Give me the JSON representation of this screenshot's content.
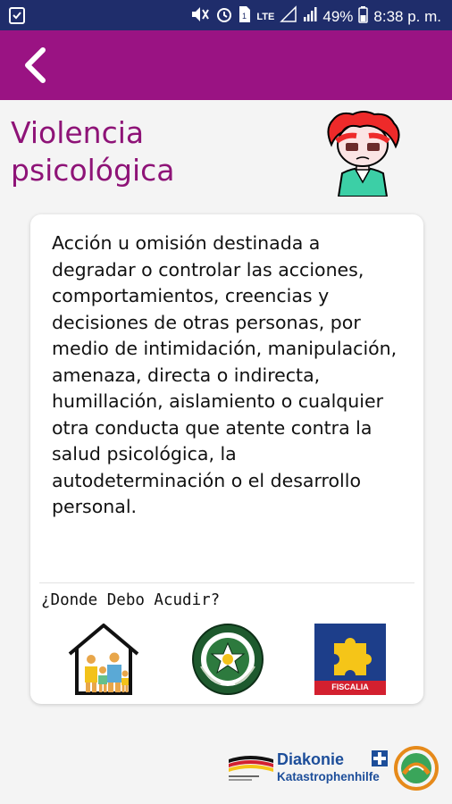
{
  "status_bar": {
    "network": "LTE",
    "battery": "49%",
    "time": "8:38 p. m."
  },
  "page": {
    "title_line1": "Violencia",
    "title_line2": "psicológica"
  },
  "card": {
    "description": "Acción u omisión destinada a degradar o controlar las acciones, comportamientos, creencias y decisiones de otras personas, por medio de intimidación, manipulación, amenaza, directa o indirecta, humillación, aislamiento o cualquier otra conducta que atente contra la salud psicológica, la autodeterminación o el desarrollo personal.",
    "where_label": "¿Donde Debo Acudir?",
    "institutions": [
      {
        "icon": "family-house-icon"
      },
      {
        "icon": "police-badge-icon"
      },
      {
        "icon": "fiscalia-logo",
        "label": "FISCALIA"
      }
    ]
  },
  "footer": {
    "brand": "Diakonie",
    "sub_brand": "Katastrophenhilfe"
  },
  "colors": {
    "status_bar": "#1f2d6b",
    "app_bar": "#9a1383",
    "title": "#8e1377",
    "background": "#f4f4f4"
  }
}
